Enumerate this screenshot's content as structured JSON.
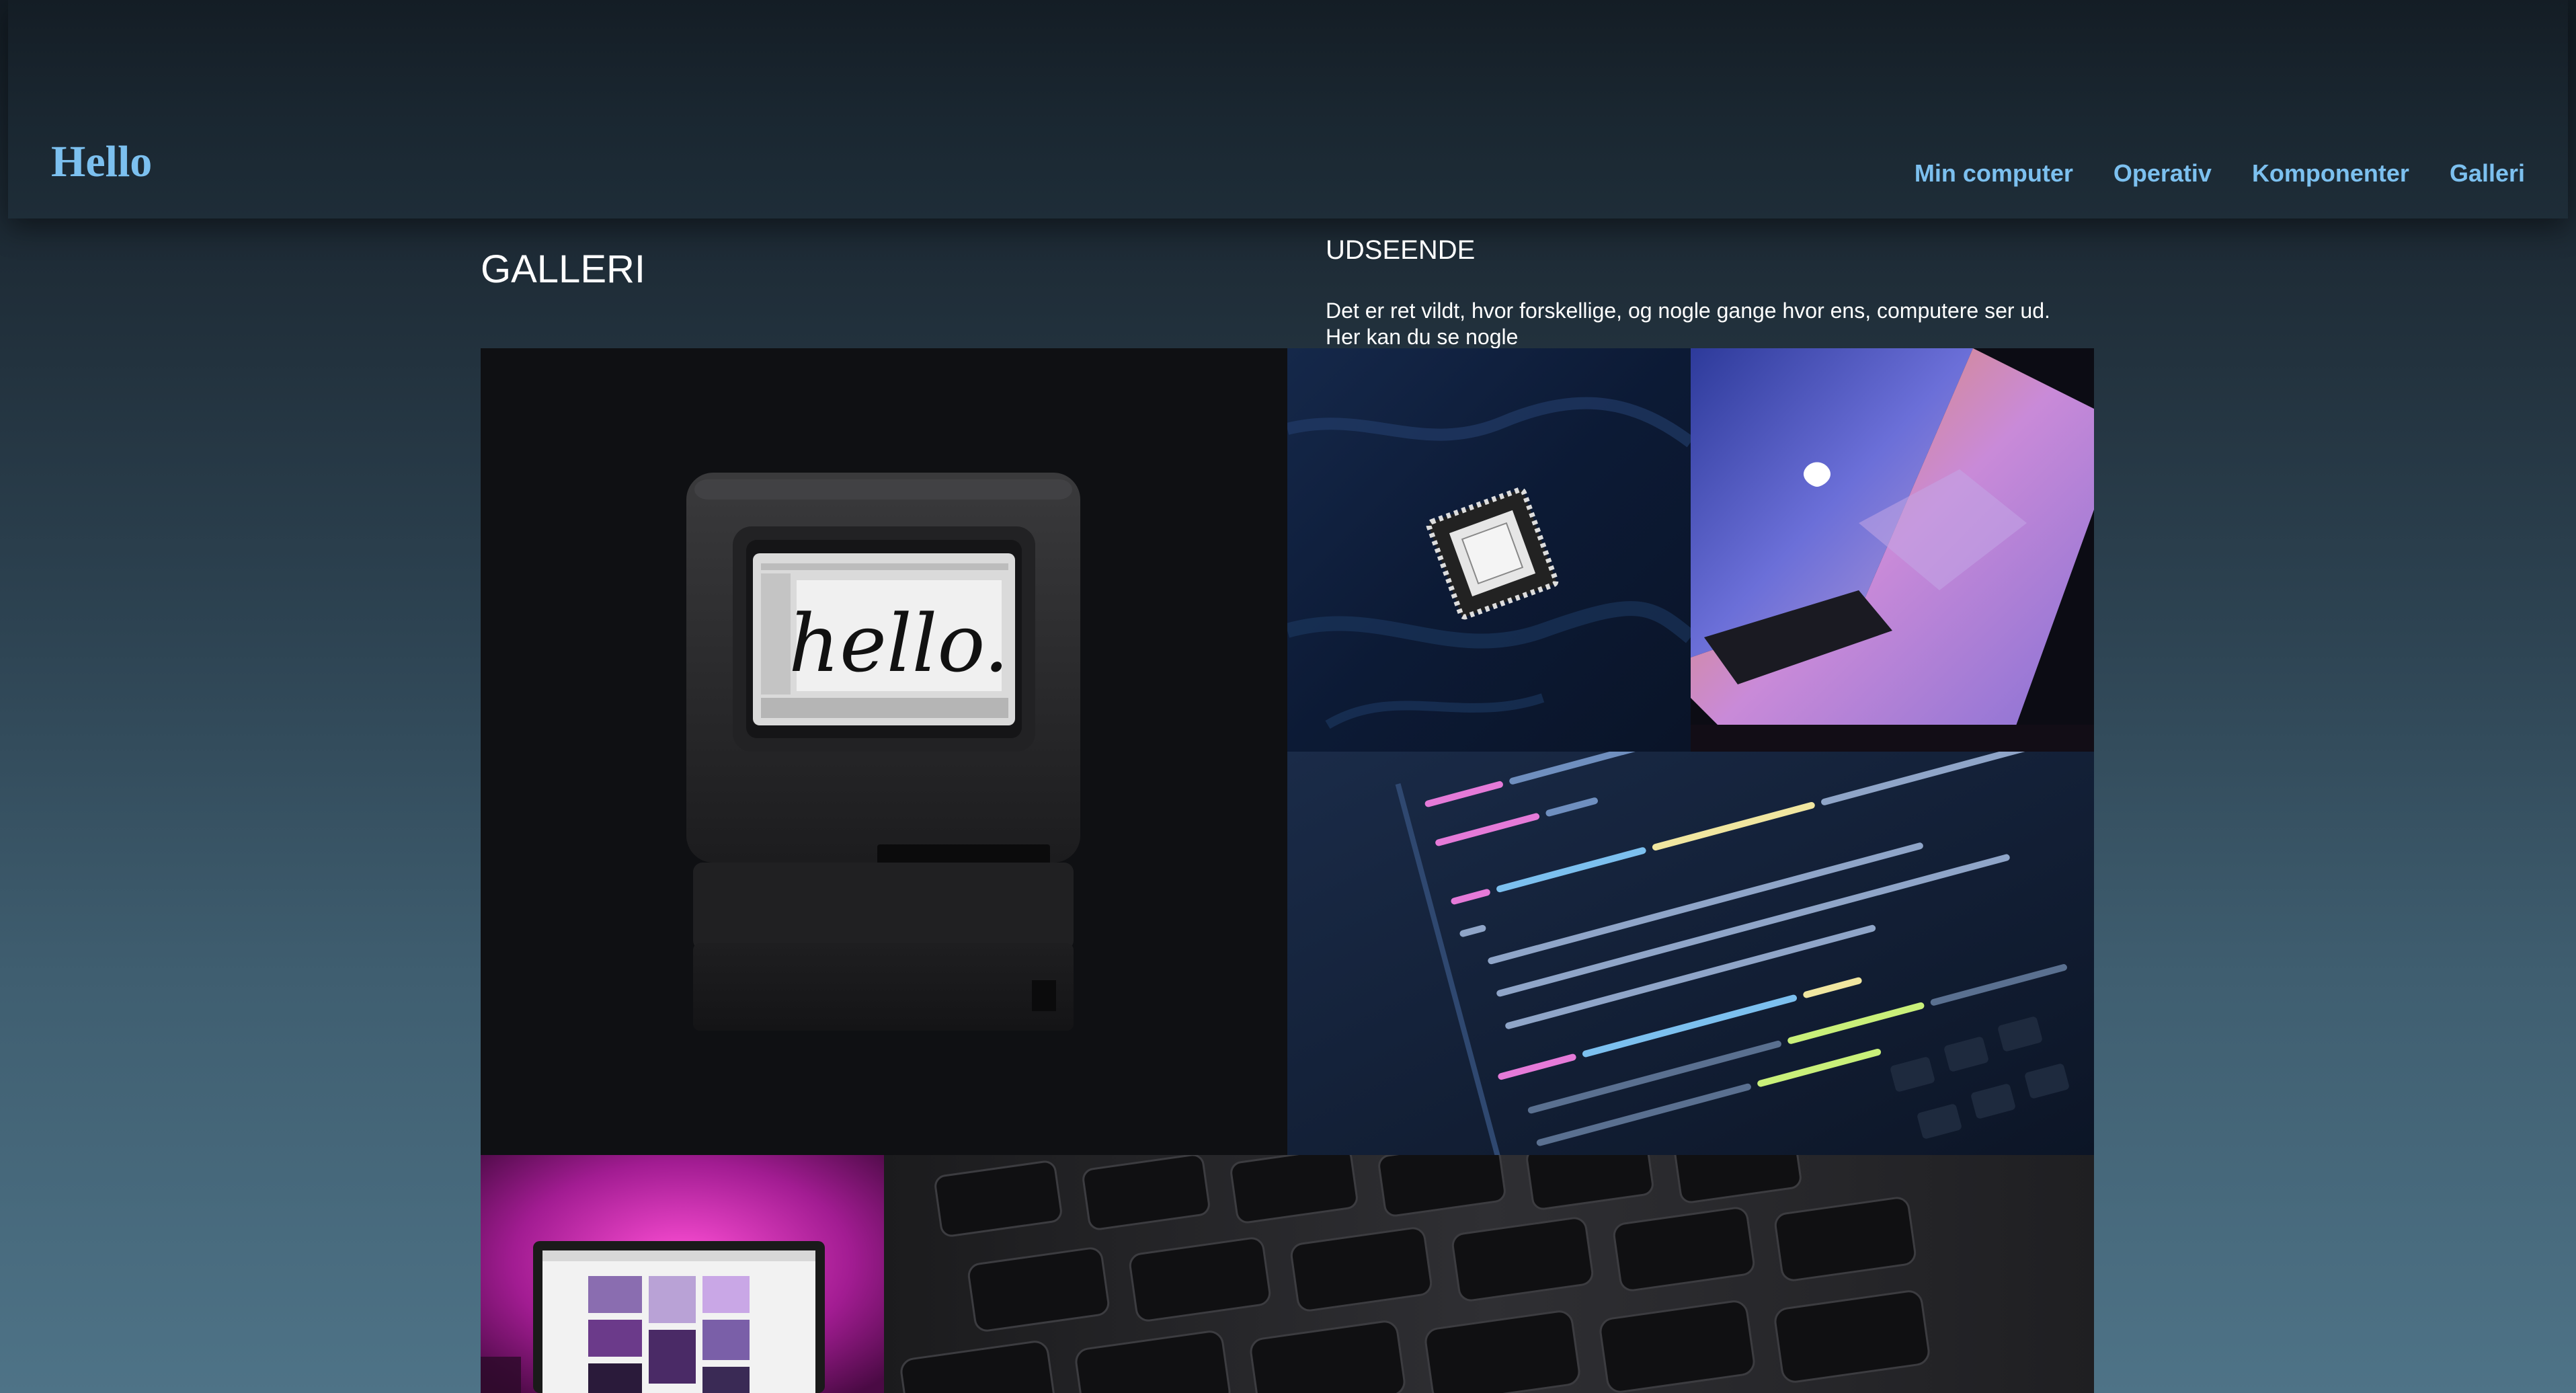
{
  "header": {
    "logo": "Hello",
    "nav": [
      "Min computer",
      "Operativ",
      "Komponenter",
      "Galleri"
    ]
  },
  "main": {
    "title": "GALLERI",
    "side_heading": "UDSEENDE",
    "side_text_line1": "Det er ret vildt, hvor forskellige, og nogle gange hvor ens, computere ser ud.",
    "side_text_line2": "Her kan du se nogle"
  },
  "gallery": {
    "hello_screen_text": "hello."
  },
  "colors": {
    "accent": "#7cc0ef",
    "text": "#ffffff",
    "header_bg": "#1a2731"
  }
}
